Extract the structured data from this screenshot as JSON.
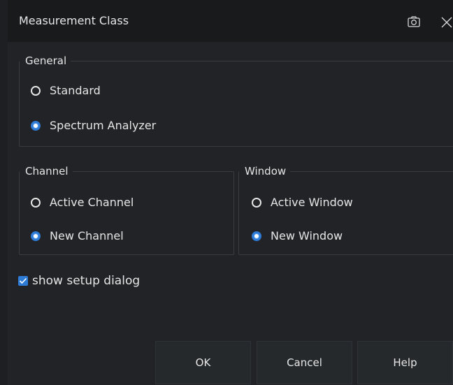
{
  "dialog": {
    "title": "Measurement Class",
    "camera_icon": "camera-icon",
    "close_icon": "close-icon"
  },
  "general": {
    "legend": "General",
    "options": [
      {
        "label": "Standard",
        "selected": false
      },
      {
        "label": "Spectrum Analyzer",
        "selected": true
      }
    ]
  },
  "channel": {
    "legend": "Channel",
    "options": [
      {
        "label": "Active Channel",
        "selected": false
      },
      {
        "label": "New Channel",
        "selected": true
      }
    ]
  },
  "window": {
    "legend": "Window",
    "options": [
      {
        "label": "Active Window",
        "selected": false
      },
      {
        "label": "New Window",
        "selected": true
      }
    ]
  },
  "setup": {
    "label": "show setup dialog",
    "checked": true
  },
  "buttons": {
    "ok": "OK",
    "cancel": "Cancel",
    "help": "Help"
  },
  "colors": {
    "accent": "#2e7bd6",
    "background": "#212327",
    "titlebar": "#191a1c"
  }
}
